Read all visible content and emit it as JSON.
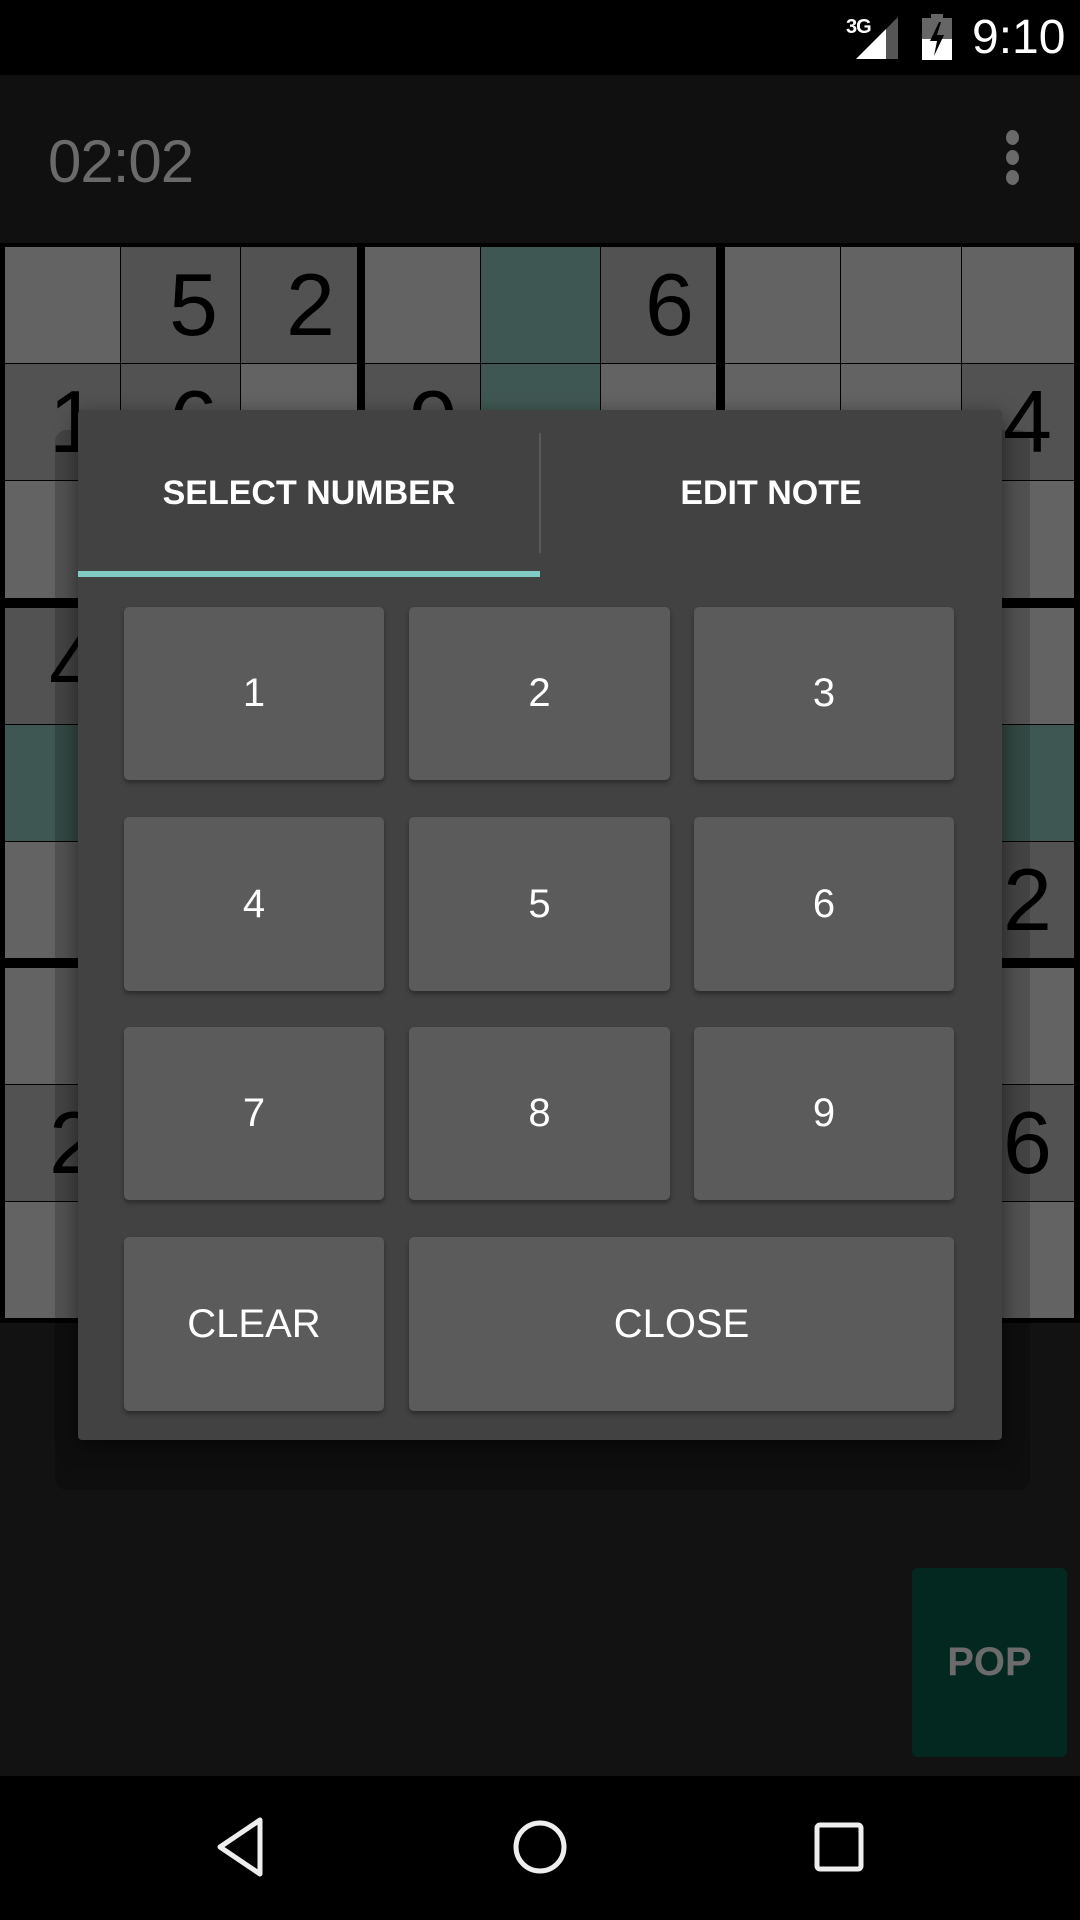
{
  "status_bar": {
    "network": "3G",
    "signal_icon": "signal-icon",
    "battery_icon": "battery-charging-icon",
    "battery_level": 0.5,
    "time": "9:10"
  },
  "toolbar": {
    "timer": "02:02",
    "overflow_icon": "more-vert-icon"
  },
  "board": {
    "rows": [
      [
        {
          "v": "",
          "s": "empty"
        },
        {
          "v": "5",
          "s": "given"
        },
        {
          "v": "2",
          "s": "given"
        },
        {
          "v": "",
          "s": "empty"
        },
        {
          "v": "",
          "s": "highlight"
        },
        {
          "v": "6",
          "s": "given"
        },
        {
          "v": "",
          "s": "empty"
        },
        {
          "v": "",
          "s": "empty"
        },
        {
          "v": "",
          "s": "empty"
        }
      ],
      [
        {
          "v": "1",
          "s": "given"
        },
        {
          "v": "6",
          "s": "given"
        },
        {
          "v": "",
          "s": "empty"
        },
        {
          "v": "9",
          "s": "given"
        },
        {
          "v": "",
          "s": "highlight"
        },
        {
          "v": "",
          "s": "empty"
        },
        {
          "v": "",
          "s": "empty"
        },
        {
          "v": "",
          "s": "empty"
        },
        {
          "v": "4",
          "s": "given"
        }
      ],
      [
        {
          "v": "",
          "s": "empty"
        },
        {
          "v": "",
          "s": "empty"
        },
        {
          "v": "",
          "s": "empty"
        },
        {
          "v": "",
          "s": "empty"
        },
        {
          "v": "",
          "s": "highlight"
        },
        {
          "v": "",
          "s": "empty"
        },
        {
          "v": "",
          "s": "empty"
        },
        {
          "v": "",
          "s": "empty"
        },
        {
          "v": "",
          "s": "empty"
        }
      ],
      [
        {
          "v": "4",
          "s": "given"
        },
        {
          "v": "",
          "s": "empty"
        },
        {
          "v": "",
          "s": "empty"
        },
        {
          "v": "",
          "s": "empty"
        },
        {
          "v": "",
          "s": "highlight"
        },
        {
          "v": "",
          "s": "empty"
        },
        {
          "v": "",
          "s": "empty"
        },
        {
          "v": "",
          "s": "empty"
        },
        {
          "v": "",
          "s": "empty"
        }
      ],
      [
        {
          "v": "",
          "s": "highlight"
        },
        {
          "v": "",
          "s": "highlight"
        },
        {
          "v": "",
          "s": "highlight"
        },
        {
          "v": "",
          "s": "highlight"
        },
        {
          "v": "",
          "s": "highlight"
        },
        {
          "v": "",
          "s": "highlight"
        },
        {
          "v": "",
          "s": "highlight"
        },
        {
          "v": "",
          "s": "highlight"
        },
        {
          "v": "",
          "s": "highlight"
        }
      ],
      [
        {
          "v": "",
          "s": "empty"
        },
        {
          "v": "",
          "s": "empty"
        },
        {
          "v": "",
          "s": "empty"
        },
        {
          "v": "",
          "s": "empty"
        },
        {
          "v": "",
          "s": "highlight"
        },
        {
          "v": "",
          "s": "empty"
        },
        {
          "v": "",
          "s": "empty"
        },
        {
          "v": "",
          "s": "empty"
        },
        {
          "v": "2",
          "s": "given"
        }
      ],
      [
        {
          "v": "",
          "s": "empty"
        },
        {
          "v": "",
          "s": "empty"
        },
        {
          "v": "",
          "s": "empty"
        },
        {
          "v": "",
          "s": "empty"
        },
        {
          "v": "",
          "s": "highlight"
        },
        {
          "v": "",
          "s": "empty"
        },
        {
          "v": "",
          "s": "empty"
        },
        {
          "v": "",
          "s": "empty"
        },
        {
          "v": "",
          "s": "empty"
        }
      ],
      [
        {
          "v": "2",
          "s": "given"
        },
        {
          "v": "",
          "s": "empty"
        },
        {
          "v": "",
          "s": "empty"
        },
        {
          "v": "",
          "s": "empty"
        },
        {
          "v": "",
          "s": "highlight"
        },
        {
          "v": "",
          "s": "empty"
        },
        {
          "v": "",
          "s": "empty"
        },
        {
          "v": "",
          "s": "empty"
        },
        {
          "v": "6",
          "s": "given"
        }
      ],
      [
        {
          "v": "",
          "s": "empty"
        },
        {
          "v": "",
          "s": "empty"
        },
        {
          "v": "",
          "s": "empty"
        },
        {
          "v": "",
          "s": "empty"
        },
        {
          "v": "",
          "s": "highlight"
        },
        {
          "v": "",
          "s": "empty"
        },
        {
          "v": "",
          "s": "empty"
        },
        {
          "v": "",
          "s": "empty"
        },
        {
          "v": "",
          "s": "empty"
        }
      ]
    ],
    "colors": {
      "empty": "#636363",
      "given": "#525252",
      "highlight": "#3f5752"
    }
  },
  "dialog": {
    "tabs": [
      {
        "label": "SELECT NUMBER",
        "active": true
      },
      {
        "label": "EDIT NOTE",
        "active": false
      }
    ],
    "accent": "#80cbc4",
    "keys": [
      "1",
      "2",
      "3",
      "4",
      "5",
      "6",
      "7",
      "8",
      "9"
    ],
    "clear_label": "CLEAR",
    "close_label": "CLOSE"
  },
  "pop_button": {
    "label": "POP"
  },
  "nav_bar": {
    "back_icon": "back-icon",
    "home_icon": "home-icon",
    "recents_icon": "recents-icon"
  }
}
